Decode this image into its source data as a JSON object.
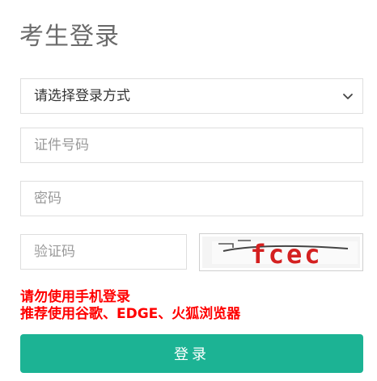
{
  "page": {
    "title": "考生登录"
  },
  "form": {
    "login_method": {
      "selected": "请选择登录方式"
    },
    "id_number": {
      "placeholder": "证件号码",
      "value": ""
    },
    "password": {
      "placeholder": "密码",
      "value": ""
    },
    "captcha_input": {
      "placeholder": "验证码",
      "value": ""
    },
    "captcha_image_text": "fcec"
  },
  "notices": {
    "line1": "请勿使用手机登录",
    "line2": "推荐使用谷歌、EDGE、火狐浏览器"
  },
  "submit": {
    "label": "登录"
  },
  "colors": {
    "accent": "#1cb394",
    "warning": "#ff0000",
    "captcha_text": "#d42020"
  },
  "icons": {
    "select_arrow": "chevron-down-icon"
  }
}
